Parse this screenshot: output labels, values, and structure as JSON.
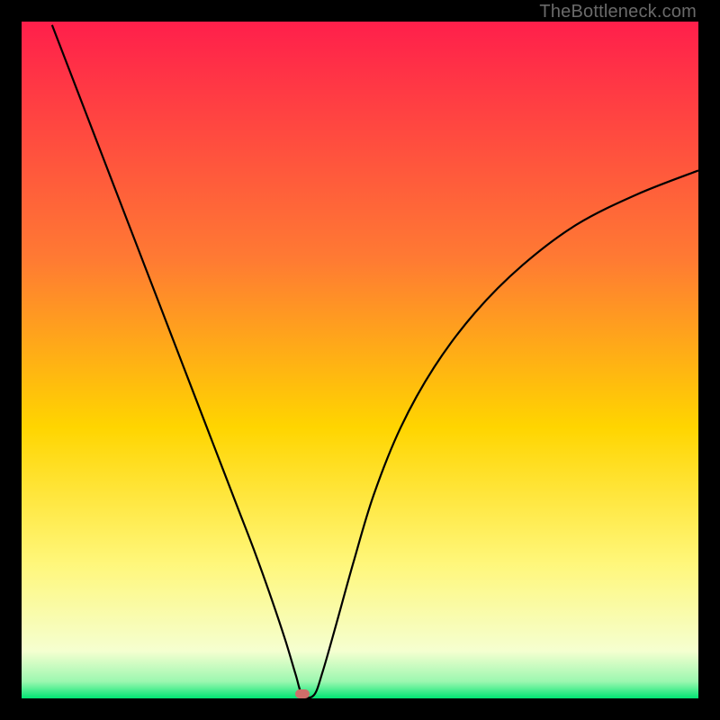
{
  "watermark": "TheBottleneck.com",
  "marker": {
    "x_frac": 0.415,
    "y_frac": 0.993,
    "color": "#cf6e6a"
  },
  "chart_data": {
    "type": "line",
    "title": "",
    "xlabel": "",
    "ylabel": "",
    "xlim": [
      0,
      1
    ],
    "ylim": [
      0,
      1
    ],
    "gradient_stops": [
      {
        "offset": 0.0,
        "color": "#ff1f4b"
      },
      {
        "offset": 0.35,
        "color": "#ff7a33"
      },
      {
        "offset": 0.6,
        "color": "#ffd500"
      },
      {
        "offset": 0.8,
        "color": "#fff77a"
      },
      {
        "offset": 0.93,
        "color": "#f5ffd0"
      },
      {
        "offset": 0.975,
        "color": "#9cf7b0"
      },
      {
        "offset": 1.0,
        "color": "#00e573"
      }
    ],
    "series": [
      {
        "name": "bottleneck-curve",
        "color": "#000000",
        "width": 2.2,
        "x": [
          0.045,
          0.07,
          0.095,
          0.12,
          0.145,
          0.17,
          0.195,
          0.22,
          0.245,
          0.27,
          0.295,
          0.32,
          0.345,
          0.37,
          0.39,
          0.405,
          0.415,
          0.432,
          0.445,
          0.465,
          0.49,
          0.52,
          0.56,
          0.61,
          0.67,
          0.74,
          0.82,
          0.91,
          1.0
        ],
        "y": [
          0.995,
          0.93,
          0.865,
          0.8,
          0.735,
          0.67,
          0.605,
          0.54,
          0.475,
          0.41,
          0.345,
          0.28,
          0.215,
          0.145,
          0.085,
          0.035,
          0.005,
          0.005,
          0.04,
          0.11,
          0.2,
          0.3,
          0.4,
          0.49,
          0.57,
          0.64,
          0.7,
          0.745,
          0.78
        ]
      }
    ],
    "annotations": [
      {
        "type": "marker",
        "x": 0.415,
        "y": 0.007,
        "shape": "rounded-rect",
        "color": "#cf6e6a"
      }
    ]
  }
}
